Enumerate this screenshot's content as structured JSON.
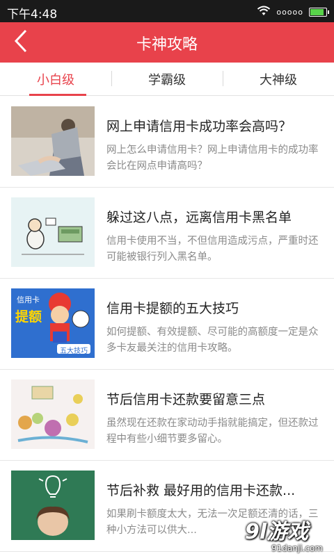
{
  "status_bar": {
    "time": "下午4:48",
    "signal": "ooooo",
    "battery_level": 0.8,
    "battery_color": "#58d34a"
  },
  "header": {
    "title": "卡神攻略",
    "back_icon": "chevron-left-icon",
    "background": "#e8424b"
  },
  "tabs": [
    {
      "label": "小白级",
      "active": true
    },
    {
      "label": "学霸级",
      "active": false
    },
    {
      "label": "大神级",
      "active": false
    }
  ],
  "articles": [
    {
      "title": "网上申请信用卡成功率会高吗？",
      "desc": "网上怎么申请信用卡？网上申请信用卡的成功率会比在网点申请高吗？",
      "thumb": "laptop-typing-photo"
    },
    {
      "title": "躲过这八点，远离信用卡黑名单",
      "desc": "信用卡使用不当，不但信用造成污点，严重时还可能被银行列入黑名单。",
      "thumb": "cartoon-credit-illustration"
    },
    {
      "title": "信用卡提额的五大技巧",
      "desc": "如何提额、有效提额、尽可能的高额度一定是众多卡友最关注的信用卡攻略。",
      "thumb": "mario-card-illustration",
      "thumb_text": {
        "top": "信用卡",
        "main": "提额",
        "bottom": "五大技巧"
      }
    },
    {
      "title": "节后信用卡还款要留意三点",
      "desc": "虽然现在还款在家动动手指就能搞定，但还款过程中有些小细节要多留心。",
      "thumb": "coins-doodle-illustration"
    },
    {
      "title": "节后补救 最好用的信用卡还款...",
      "desc": "如果刷卡额度太大，无法一次足额还清的话，三种小方法可以供大...",
      "thumb": "lightbulb-idea-photo"
    }
  ],
  "watermark": {
    "logo": "9l游戏",
    "url": "91danji.com"
  }
}
